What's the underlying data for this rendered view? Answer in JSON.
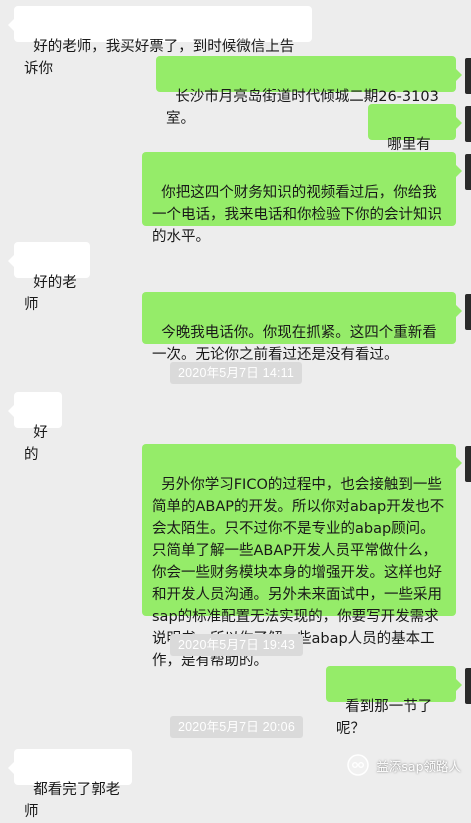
{
  "messages": [
    {
      "side": "left",
      "text": "好的老师，我买好票了，到时候微信上告诉你"
    },
    {
      "side": "right",
      "text": "长沙市月亮岛街道时代倾城二期26-3103室。"
    },
    {
      "side": "right",
      "text": "哪里有人。"
    },
    {
      "side": "right",
      "text": "你把这四个财务知识的视频看过后，你给我一个电话，我来电话和你检验下你的会计知识的水平。"
    },
    {
      "side": "left",
      "text": "好的老师"
    },
    {
      "side": "right",
      "text": "今晚我电话你。你现在抓紧。这四个重新看一次。无论你之前看过还是没有看过。"
    },
    {
      "side": "left",
      "text": "好的"
    },
    {
      "side": "right",
      "text": "另外你学习FICO的过程中，也会接触到一些简单的ABAP的开发。所以你对abap开发也不会太陌生。只不过你不是专业的abap顾问。只简单了解一些ABAP开发人员平常做什么，你会一些财务模块本身的增强开发。这样也好和开发人员沟通。另外未来面试中，一些采用sap的标准配置无法实现的，你要写开发需求说明书，所以你了解一些abap人员的基本工作，是有帮助的。"
    },
    {
      "side": "right",
      "text": "看到那一节了呢？"
    },
    {
      "side": "left",
      "text": "都看完了郭老师"
    }
  ],
  "timestamps": [
    "2020年5月7日 14:11",
    "2020年5月7日 19:43",
    "2020年5月7日 20:06"
  ],
  "watermark": {
    "text": "益添sap领路人"
  },
  "colors": {
    "background": "#ededed",
    "sent_bubble": "#95ec69",
    "received_bubble": "#ffffff",
    "timestamp_bg": "#dadada"
  },
  "icons": {
    "watermark": "wechat-official-account-icon"
  }
}
